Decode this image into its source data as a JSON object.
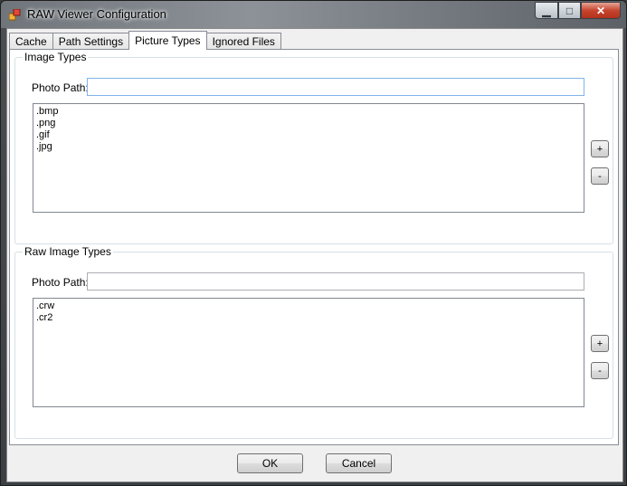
{
  "window": {
    "title": "RAW Viewer Configuration",
    "controls": {
      "minimize": "▁",
      "maximize": "□",
      "close": "✕"
    }
  },
  "tabs": [
    {
      "label": "Cache"
    },
    {
      "label": "Path Settings"
    },
    {
      "label": "Picture Types",
      "active": true
    },
    {
      "label": "Ignored Files"
    }
  ],
  "image_types": {
    "legend": "Image Types",
    "photo_path_label": "Photo Path:",
    "photo_path_value": "",
    "extensions": [
      ".bmp",
      ".png",
      ".gif",
      ".jpg"
    ],
    "add_label": "+",
    "remove_label": "-"
  },
  "raw_image_types": {
    "legend": "Raw Image Types",
    "photo_path_label": "Photo Path:",
    "photo_path_value": "",
    "extensions": [
      ".crw",
      ".cr2"
    ],
    "add_label": "+",
    "remove_label": "-"
  },
  "buttons": {
    "ok": "OK",
    "cancel": "Cancel"
  }
}
